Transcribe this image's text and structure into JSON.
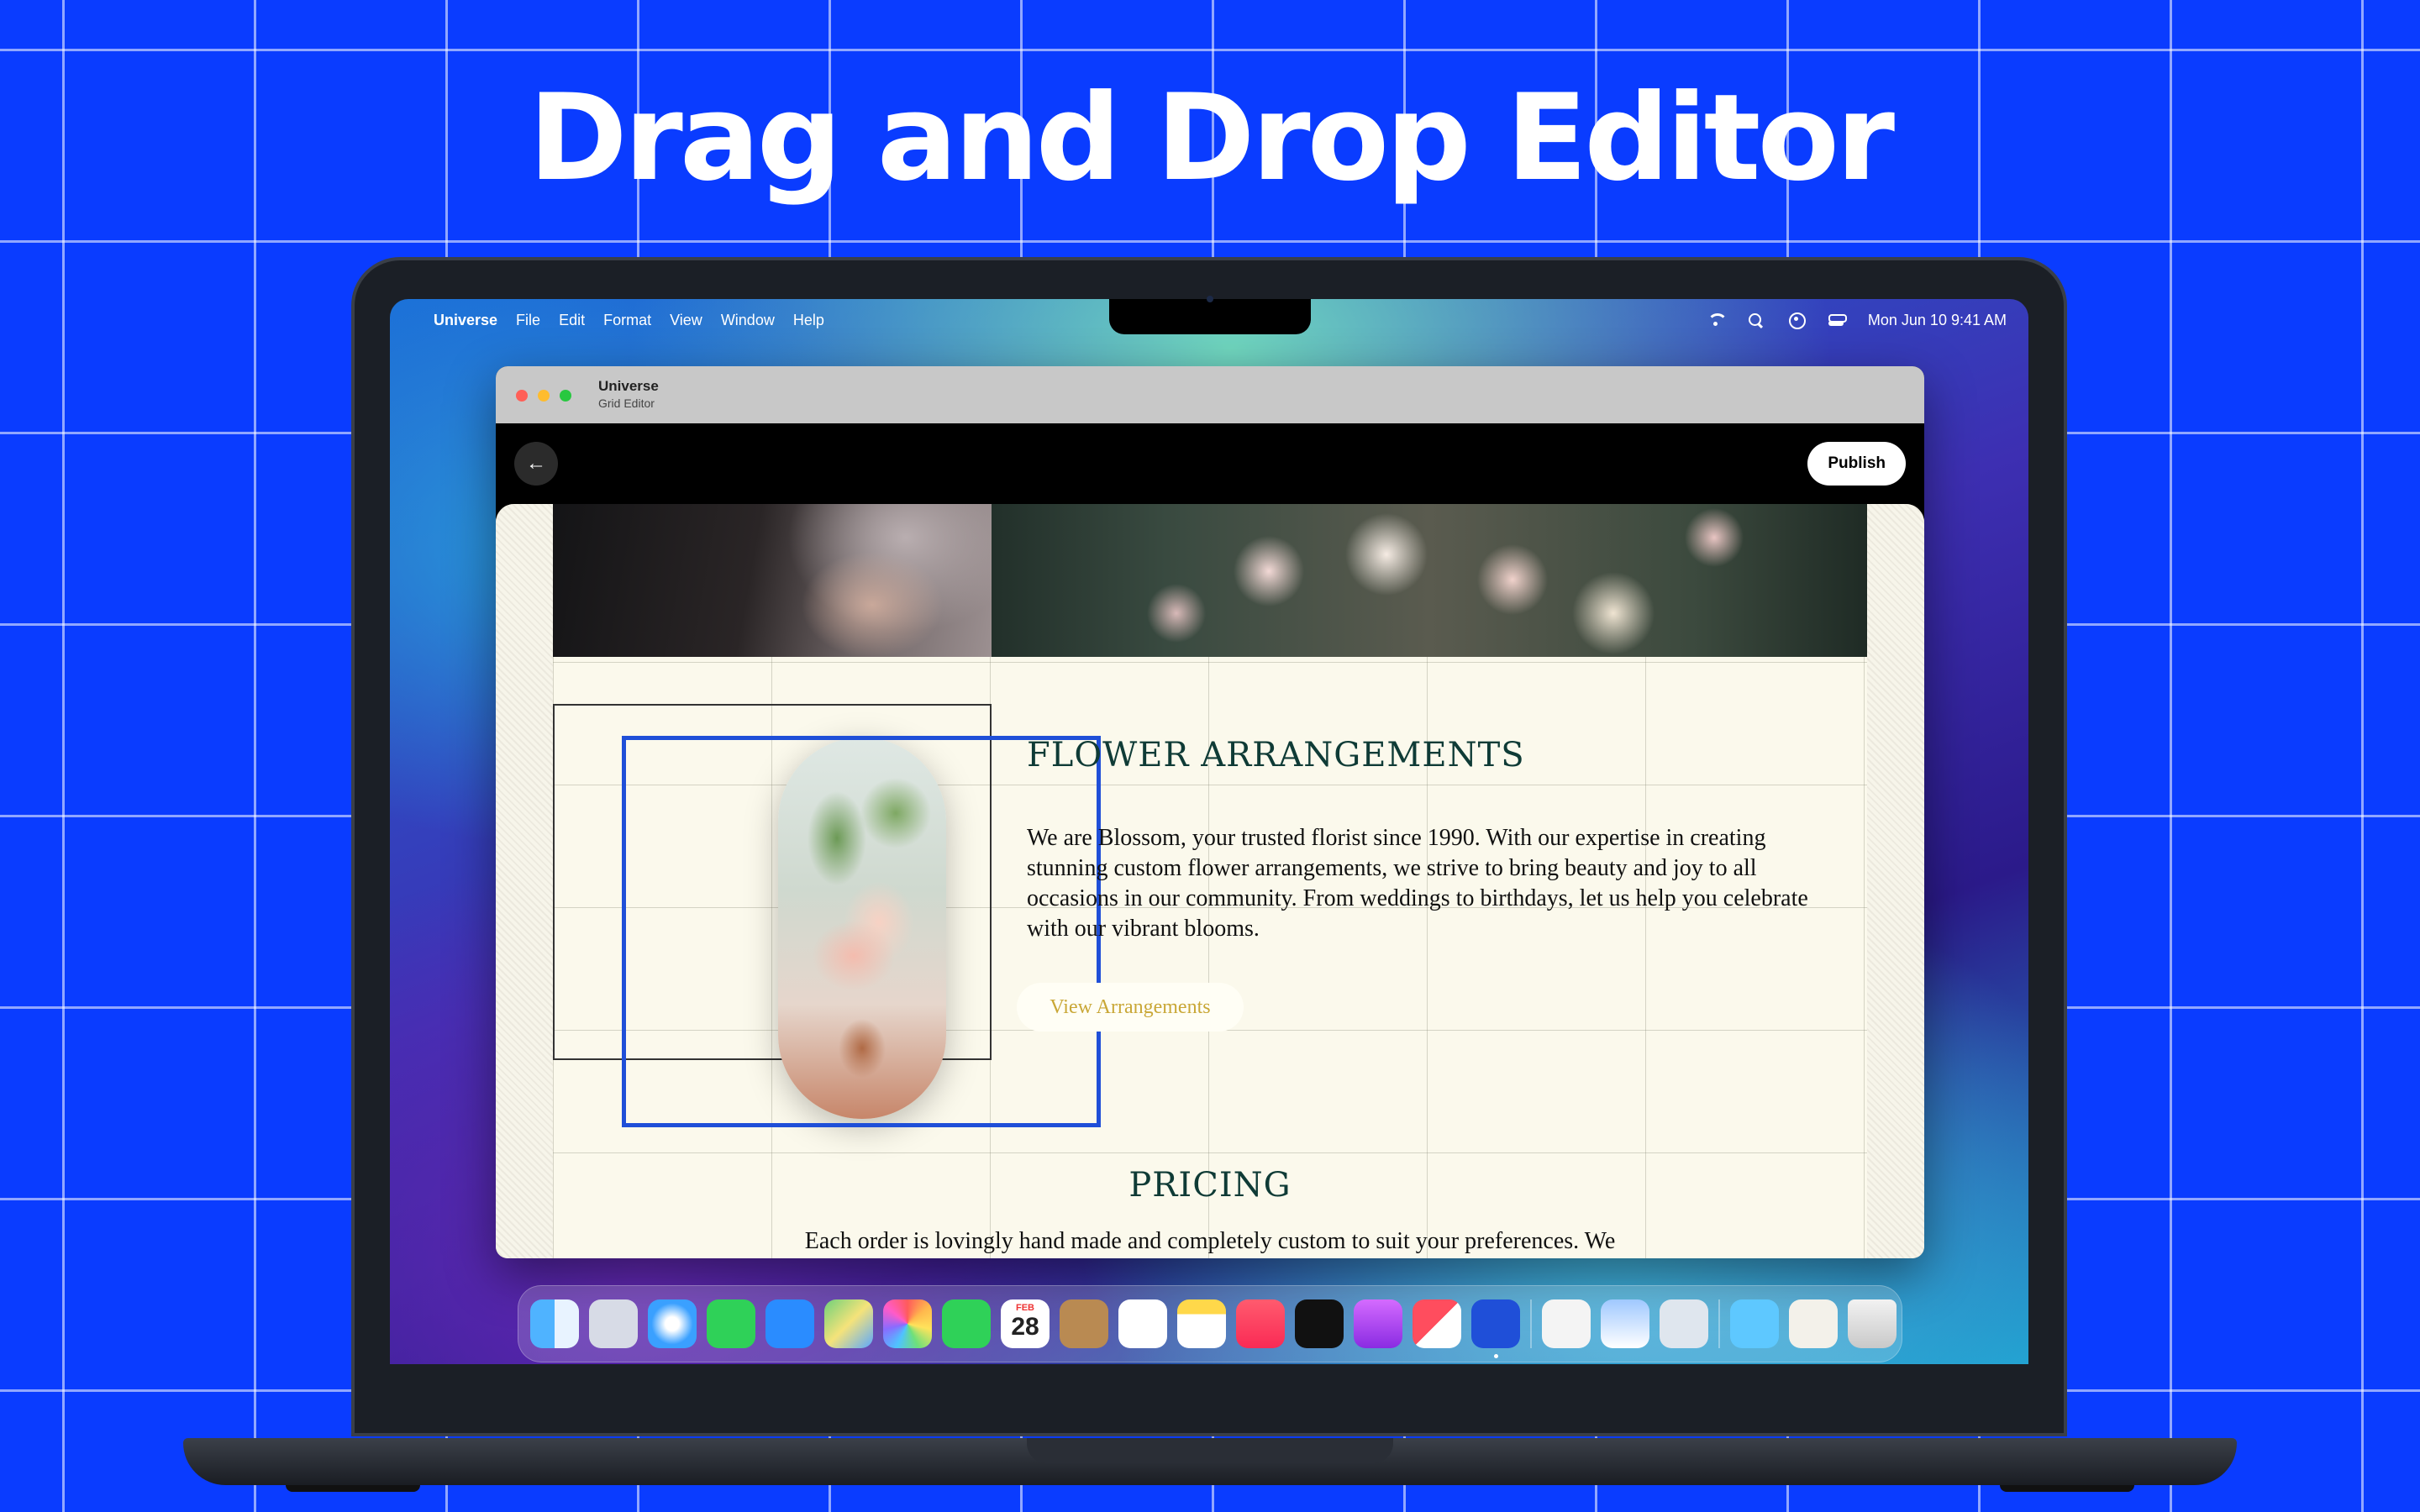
{
  "headline": "Drag and Drop Editor",
  "menubar": {
    "app_name": "Universe",
    "items": [
      "File",
      "Edit",
      "Format",
      "View",
      "Window",
      "Help"
    ],
    "datetime": "Mon Jun 10  9:41 AM"
  },
  "window": {
    "title": "Universe",
    "subtitle": "Grid Editor",
    "back_icon": "←",
    "publish_label": "Publish"
  },
  "content": {
    "section_title": "FLOWER ARRANGEMENTS",
    "section_body": "We are Blossom, your trusted florist since 1990. With our expertise in creating stunning custom flower arrangements, we strive to bring beauty and joy to all occasions in our community. From weddings to birthdays, let us help you celebrate with our vibrant blooms.",
    "button_label": "View Arrangements",
    "pricing_title": "PRICING",
    "pricing_body": "Each order is lovingly hand made and completely custom to suit your preferences. We"
  },
  "dock": {
    "calendar_month": "FEB",
    "calendar_day": "28"
  },
  "colors": {
    "background": "#0a3cff",
    "accent_blue": "#1f4fd8",
    "heading_green": "#0f3b36",
    "button_gold": "#c9a736",
    "canvas_cream": "#fbf9ec"
  }
}
